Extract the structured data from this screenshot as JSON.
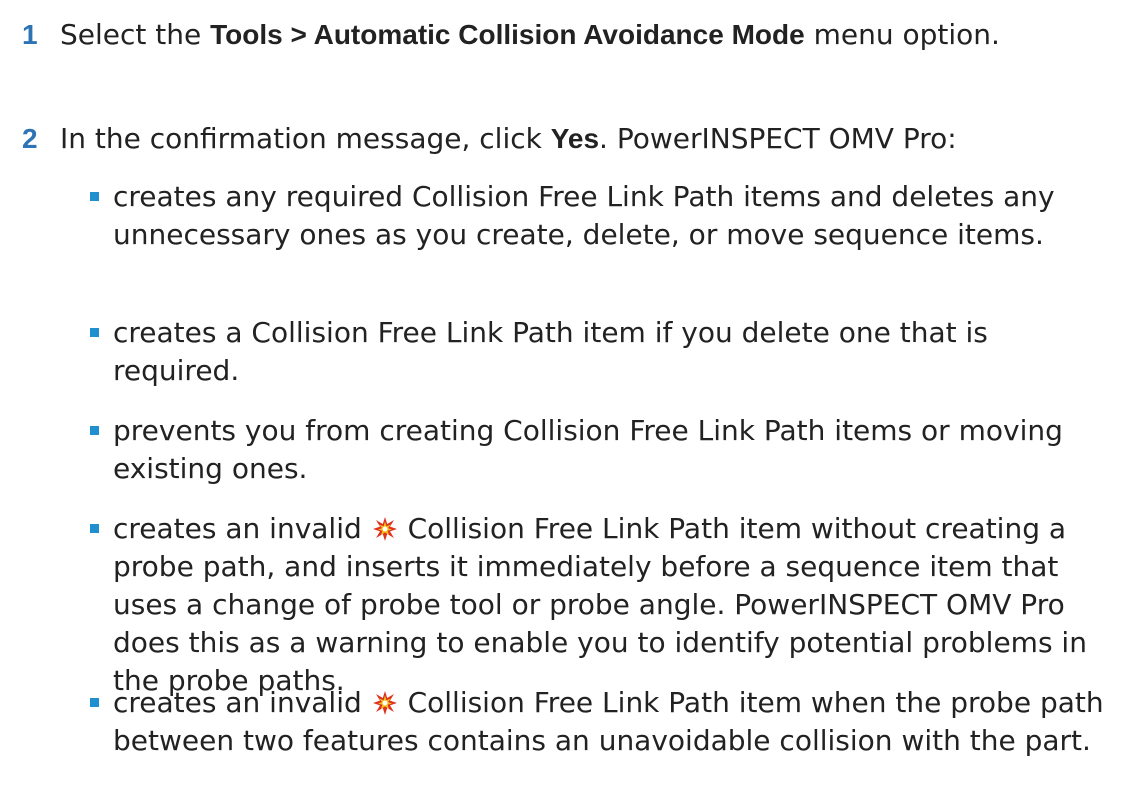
{
  "steps": [
    {
      "number": "1",
      "pre": "Select the ",
      "bold": "Tools > Automatic Collision Avoidance Mode",
      "post": " menu option."
    },
    {
      "number": "2",
      "pre": "In the confirmation message, click ",
      "bold": "Yes",
      "post": ". PowerINSPECT OMV Pro:"
    }
  ],
  "bullets": [
    {
      "text": "creates any required Collision Free Link Path items and deletes any unnecessary ones as you create, delete, or move sequence items."
    },
    {
      "text": "creates a Collision Free Link Path item if you delete one that is required."
    },
    {
      "text": "prevents you from creating Collision Free Link Path items or moving existing ones."
    },
    {
      "pre": "creates an invalid",
      "icon": "invalid-collision-path-icon",
      "post": "Collision Free Link Path item without creating a probe path, and inserts it immediately before a sequence item that uses a change of probe tool or probe angle. PowerINSPECT OMV Pro does this as a warning to enable you to identify potential problems in the probe paths."
    },
    {
      "pre": "creates an invalid",
      "icon": "invalid-collision-path-icon",
      "post": "Collision Free Link Path item when the probe path between two features contains an unavoidable collision with the part."
    }
  ],
  "colors": {
    "step_number": "#2e74b5",
    "bullet_marker": "#1f8fd0",
    "text": "#222222",
    "icon_red": "#e0301e",
    "icon_yellow": "#f2c21a"
  }
}
